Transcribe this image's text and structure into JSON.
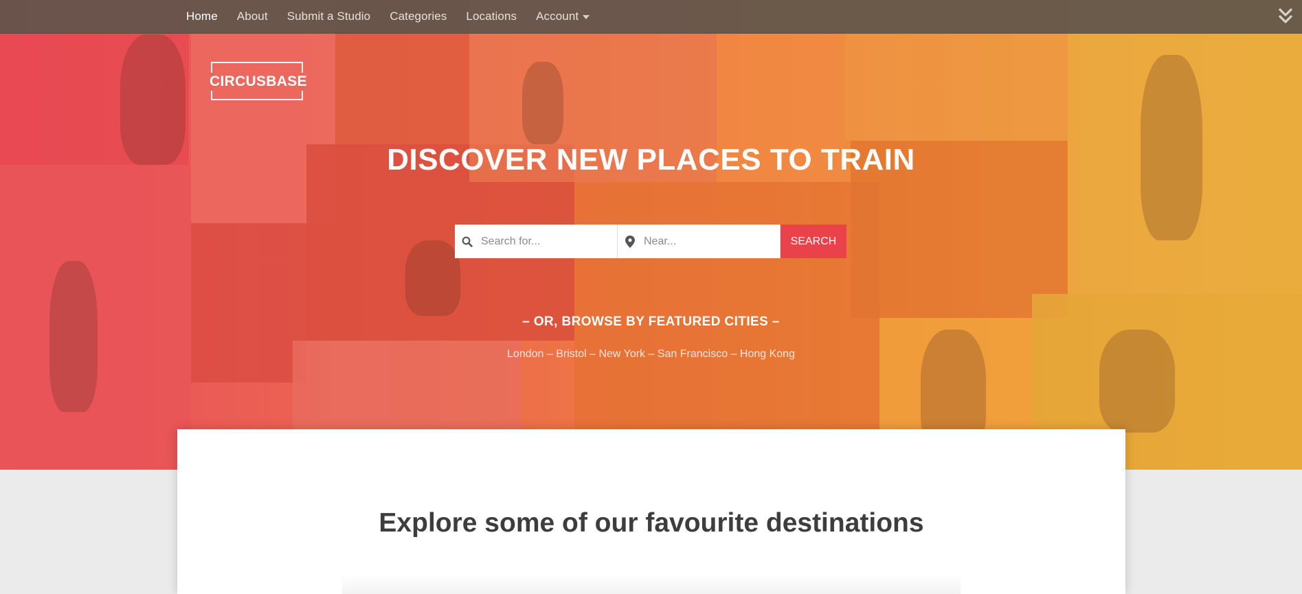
{
  "nav": {
    "links": [
      {
        "label": "Home",
        "active": true
      },
      {
        "label": "About"
      },
      {
        "label": "Submit a Studio"
      },
      {
        "label": "Categories"
      },
      {
        "label": "Locations"
      },
      {
        "label": "Account",
        "dropdown": true
      }
    ],
    "toggle_icon": "double-chevron-down-icon"
  },
  "logo": {
    "text": "CIRCUSBASE"
  },
  "hero": {
    "headline": "DISCOVER NEW PLACES TO TRAIN",
    "search": {
      "what_placeholder": "Search for...",
      "where_placeholder": "Near...",
      "button_label": "SEARCH",
      "what_icon": "search-icon",
      "where_icon": "map-pin-icon"
    },
    "browse_heading": "– OR, BROWSE BY FEATURED CITIES –",
    "cities": [
      "London",
      "Bristol",
      "New York",
      "San Francisco",
      "Hong Kong"
    ],
    "city_separator": " – "
  },
  "main": {
    "section_title": "Explore some of our favourite destinations"
  },
  "colors": {
    "nav_bg": "#5f554b",
    "hero_left": "#e8505e",
    "hero_right": "#efb13a",
    "search_button": "#e9424a",
    "page_bg": "#ebebeb",
    "title_text": "#3d3d3d"
  }
}
